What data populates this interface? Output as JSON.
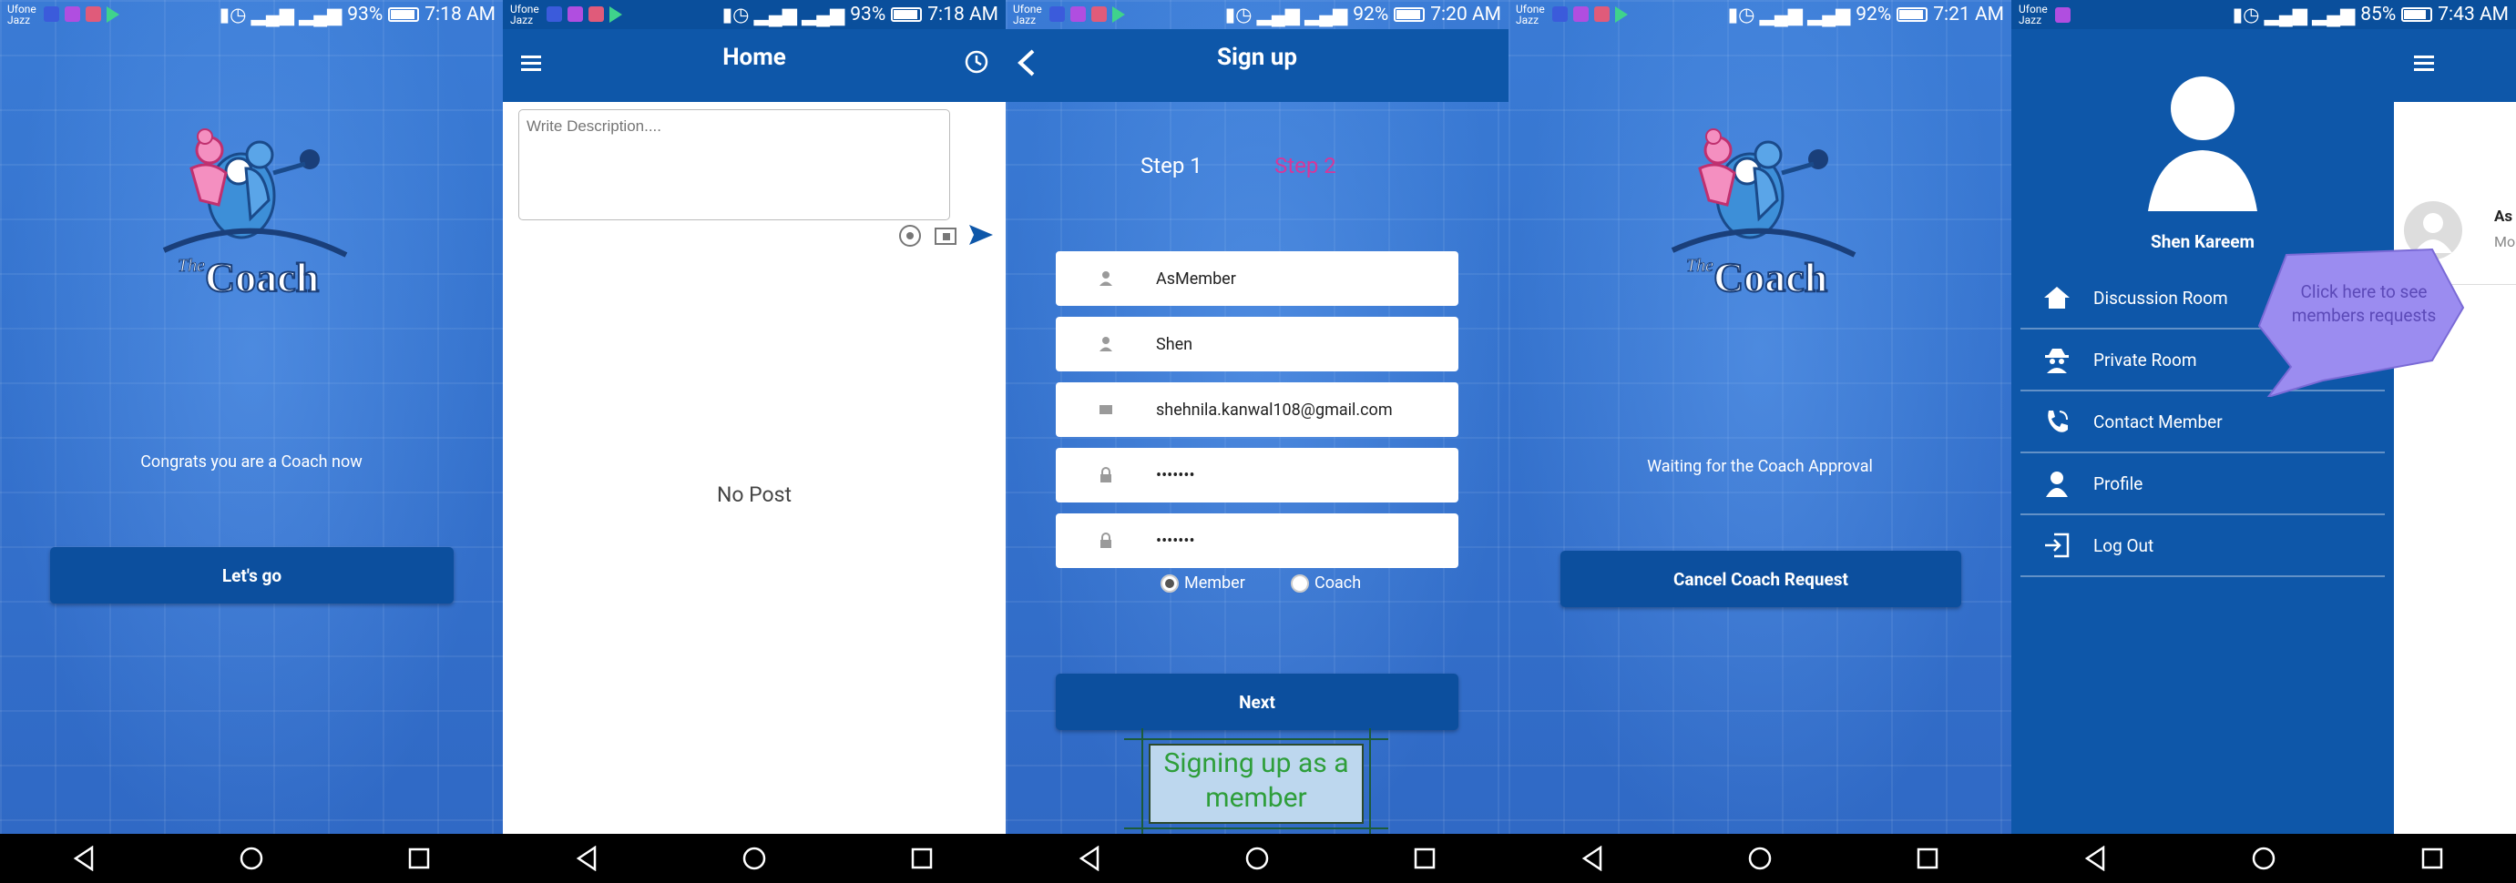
{
  "screens": [
    {
      "status": {
        "carrier": "Ufone Jazz",
        "battery": "93%",
        "time": "7:18 AM"
      },
      "message": "Congrats you are a Coach now",
      "button": "Let's go"
    },
    {
      "status": {
        "carrier": "Ufone Jazz",
        "battery": "93%",
        "time": "7:18 AM"
      },
      "title": "Home",
      "description_placeholder": "Write Description....",
      "empty_text": "No Post"
    },
    {
      "status": {
        "carrier": "Ufone Jazz",
        "battery": "92%",
        "time": "7:20 AM"
      },
      "title": "Sign up",
      "step1": "Step 1",
      "step2": "Step 2",
      "fields": {
        "username": "AsMember",
        "name": "Shen",
        "email": "shehnila.kanwal108@gmail.com",
        "password": "•••••••",
        "confirm_password": "•••••••"
      },
      "radio_member": "Member",
      "radio_coach": "Coach",
      "button": "Next",
      "annotation": "Signing up as a member"
    },
    {
      "status": {
        "carrier": "Ufone Jazz",
        "battery": "92%",
        "time": "7:21 AM"
      },
      "message": "Waiting for the Coach Approval",
      "button": "Cancel Coach Request"
    },
    {
      "status": {
        "carrier": "Ufone Jazz",
        "battery": "85%",
        "time": "7:43 AM"
      },
      "user_name": "Shen Kareem",
      "menu": [
        {
          "label": "Discussion Room",
          "icon": "home-icon"
        },
        {
          "label": "Private Room",
          "icon": "spy-icon"
        },
        {
          "label": "Contact Member",
          "icon": "phone-icon"
        },
        {
          "label": "Profile",
          "icon": "person-icon"
        },
        {
          "label": "Log Out",
          "icon": "logout-icon"
        }
      ],
      "callout": "Click here to see members requests",
      "peek_name": "As",
      "peek_sub": "Mo"
    }
  ],
  "logo": {
    "prefix": "The",
    "word": "Coach"
  },
  "colors": {
    "appbar": "#0e57a9",
    "button": "#0c4f9e",
    "step_active": "#ffffff",
    "step_inactive": "#d6379a",
    "annotation": "#2e9e3a",
    "callout": "#9b8cf0"
  }
}
